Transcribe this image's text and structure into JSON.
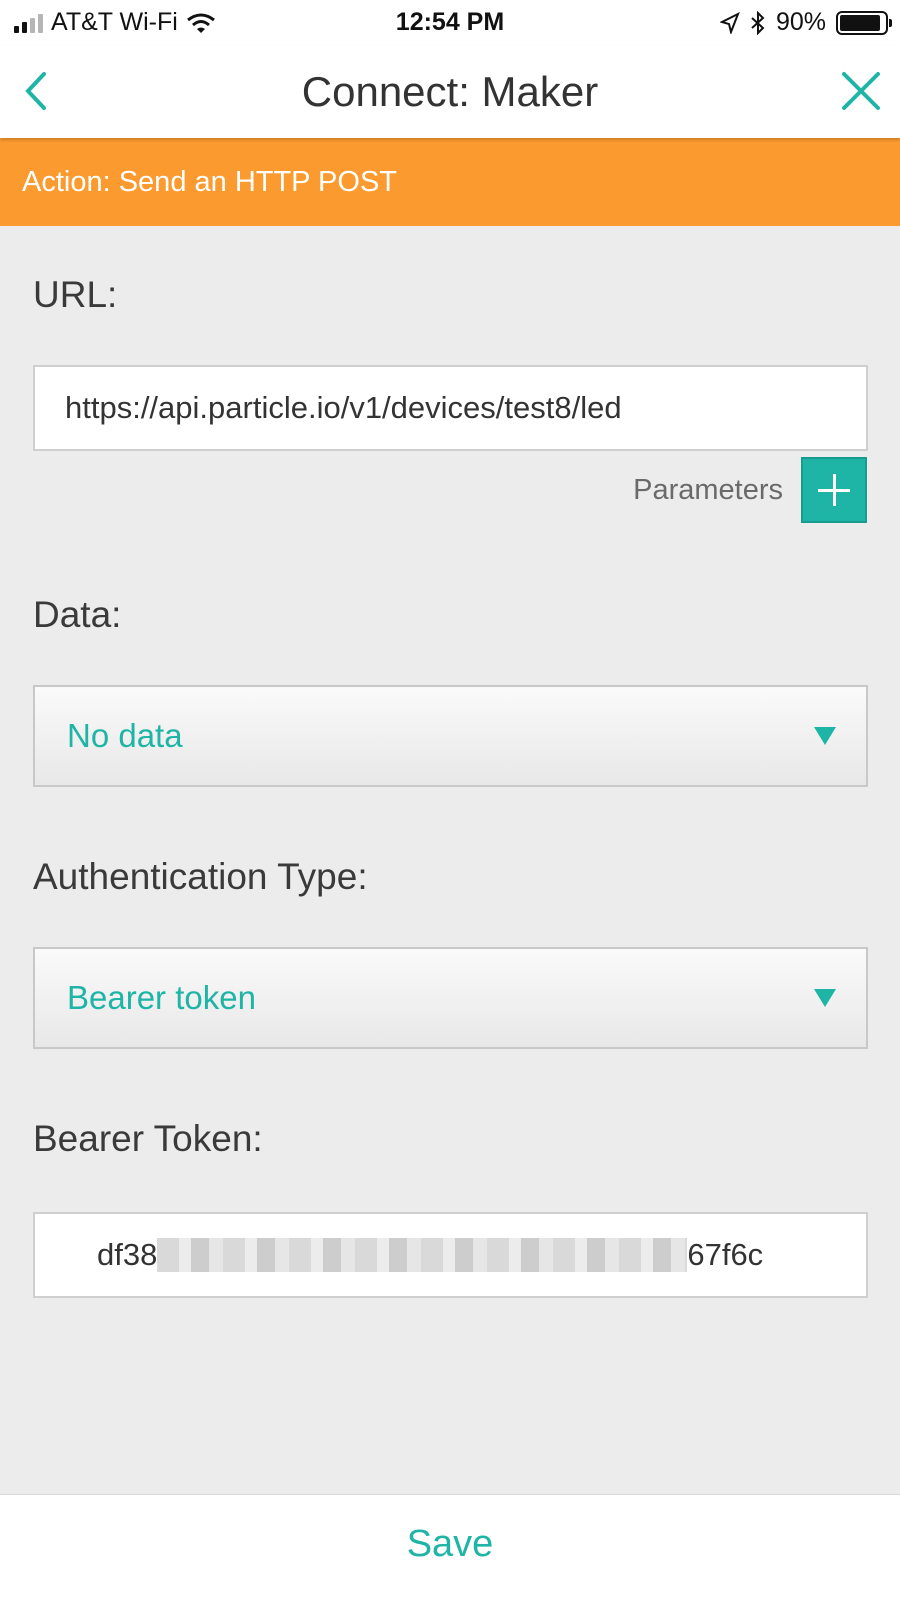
{
  "status_bar": {
    "carrier": "AT&T Wi-Fi",
    "time": "12:54 PM",
    "battery": "90%",
    "battery_level": 0.9
  },
  "nav": {
    "title": "Connect: Maker",
    "back_icon": "chevron-left-icon",
    "close_icon": "close-icon"
  },
  "action_banner": "Action: Send an HTTP POST",
  "url": {
    "label": "URL:",
    "value": "https://api.particle.io/v1/devices/test8/led",
    "params_label": "Parameters"
  },
  "data": {
    "label": "Data:",
    "selected": "No data"
  },
  "auth": {
    "label": "Authentication Type:",
    "selected": "Bearer token"
  },
  "token": {
    "label": "Bearer Token:",
    "prefix": "df38",
    "suffix": "67f6c"
  },
  "footer": {
    "save_label": "Save"
  },
  "colors": {
    "accent": "#1fb5a6",
    "banner": "#fb9a2e",
    "background": "#ececec"
  }
}
